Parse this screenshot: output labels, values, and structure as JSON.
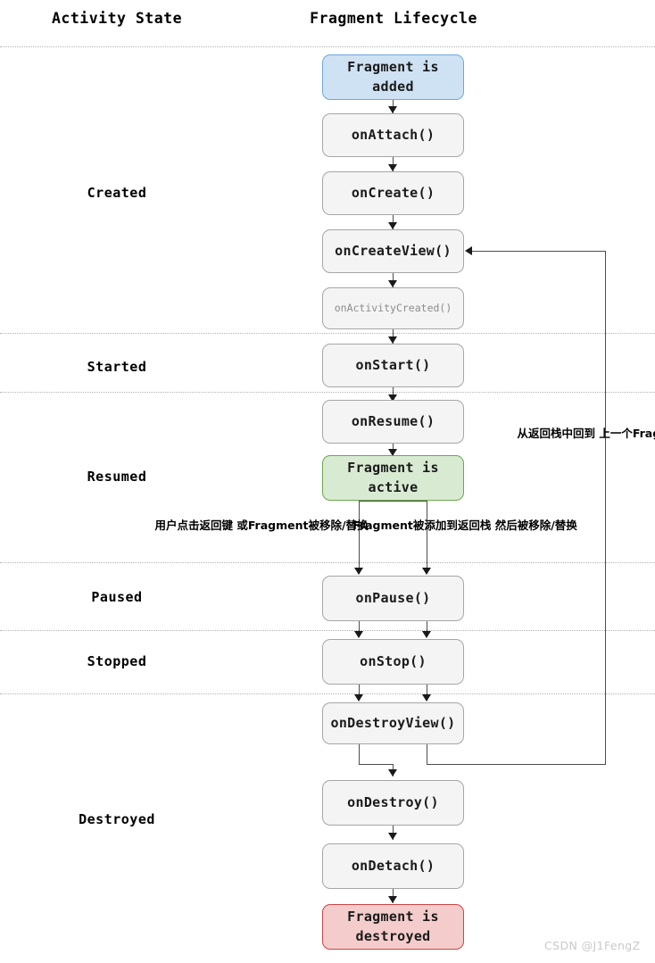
{
  "headers": {
    "activity_state": "Activity State",
    "fragment_lifecycle": "Fragment Lifecycle"
  },
  "states": [
    {
      "label": "Created"
    },
    {
      "label": "Started"
    },
    {
      "label": "Resumed"
    },
    {
      "label": "Paused"
    },
    {
      "label": "Stopped"
    },
    {
      "label": "Destroyed"
    }
  ],
  "nodes": [
    {
      "id": "fragment-added",
      "line1": "Fragment is",
      "line2": "added",
      "kind": "terminal-added"
    },
    {
      "id": "on-attach",
      "line1": "onAttach()",
      "line2": "",
      "kind": "callback"
    },
    {
      "id": "on-create",
      "line1": "onCreate()",
      "line2": "",
      "kind": "callback"
    },
    {
      "id": "on-create-view",
      "line1": "onCreateView()",
      "line2": "",
      "kind": "callback"
    },
    {
      "id": "on-activity-created",
      "line1": "onActivityCreated()",
      "line2": "",
      "kind": "deprecated"
    },
    {
      "id": "on-start",
      "line1": "onStart()",
      "line2": "",
      "kind": "callback"
    },
    {
      "id": "on-resume",
      "line1": "onResume()",
      "line2": "",
      "kind": "callback"
    },
    {
      "id": "fragment-active",
      "line1": "Fragment is",
      "line2": "active",
      "kind": "terminal-active"
    },
    {
      "id": "on-pause",
      "line1": "onPause()",
      "line2": "",
      "kind": "callback"
    },
    {
      "id": "on-stop",
      "line1": "onStop()",
      "line2": "",
      "kind": "callback"
    },
    {
      "id": "on-destroy-view",
      "line1": "onDestroyView()",
      "line2": "",
      "kind": "callback"
    },
    {
      "id": "on-destroy",
      "line1": "onDestroy()",
      "line2": "",
      "kind": "callback"
    },
    {
      "id": "on-detach",
      "line1": "onDetach()",
      "line2": "",
      "kind": "callback"
    },
    {
      "id": "fragment-destroyed",
      "line1": "Fragment is",
      "line2": "destroyed",
      "kind": "terminal-destroyed"
    }
  ],
  "annotations": {
    "back_pressed": {
      "line1": "用户点击返回键",
      "line2": "或Fragment被移除/替换"
    },
    "back_stack": {
      "line1": "Fragment被添加到返回栈",
      "line2": "然后被移除/替换"
    },
    "restore": {
      "line1": "从返回栈中回到",
      "line2": "上一个Fragment"
    }
  },
  "watermark": "CSDN @J1FengZ",
  "colors": {
    "added_fill": "#cfe2f3",
    "added_border": "#6fa8dc",
    "active_fill": "#d9ead3",
    "active_border": "#6aa84f",
    "destroyed_fill": "#f4cccc",
    "destroyed_border": "#cc4444",
    "callback_fill": "#f4f4f4",
    "callback_border": "#a6a6a6",
    "line": "#4d4d4d",
    "divider": "#b3b3b3",
    "deprecated_text": "#8c8c8c",
    "watermark_text": "#c9c9c9"
  }
}
